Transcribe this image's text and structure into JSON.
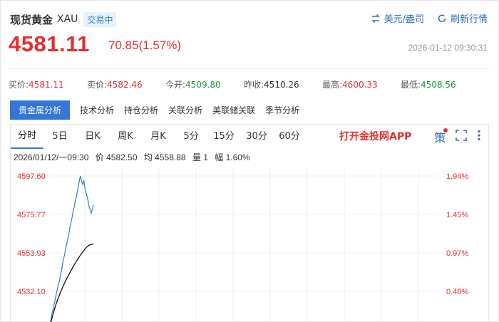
{
  "header": {
    "name": "现货黄金",
    "code": "XAU",
    "status": "交易中",
    "currency_btn": "美元/盎司",
    "refresh_btn": "刷新行情"
  },
  "quote": {
    "price": "4581.11",
    "change": "70.85(1.57%)",
    "time": "2026-01-12 09:30:31"
  },
  "stats": [
    {
      "label": "买价:",
      "value": "4581.11",
      "color": "red"
    },
    {
      "label": "卖价:",
      "value": "4582.46",
      "color": "red"
    },
    {
      "label": "今开:",
      "value": "4509.80",
      "color": "green"
    },
    {
      "label": "昨收:",
      "value": "4510.26",
      "color": "gray"
    },
    {
      "label": "最高:",
      "value": "4600.33",
      "color": "red"
    },
    {
      "label": "最低:",
      "value": "4508.56",
      "color": "green"
    }
  ],
  "analysis_tabs": [
    "贵金属分析",
    "技术分析",
    "持仓分析",
    "关联分析",
    "美联储关联",
    "季节分析"
  ],
  "period_tabs": [
    "分时",
    "5日",
    "日K",
    "周K",
    "月K",
    "5分",
    "15分",
    "30分",
    "60分"
  ],
  "promo": "打开金投网APP",
  "strategy_icon_label": "策",
  "info": {
    "datetime": "2026/01/12/一09:30",
    "price": "价 4582.50",
    "avg": "均 4558.88",
    "vol": "量 1",
    "amp": "幅 1.60%"
  },
  "chart_data": {
    "type": "line",
    "y_labels_left": [
      "4597.60",
      "4575.77",
      "4553.93",
      "4532.10"
    ],
    "y_labels_right": [
      "1.94%",
      "1.45%",
      "0.97%",
      "0.48%"
    ],
    "ylim": [
      4510.26,
      4597.6
    ],
    "series": [
      {
        "name": "",
        "color": "#2f7fd8",
        "values": [
          4512.5,
          4516.2,
          4519.8,
          4522.1,
          4524.9,
          4527.3,
          4530.6,
          4533.2,
          4535.8,
          4538.1,
          4541.4,
          4544.2,
          4547.9,
          4550.6,
          4553.4,
          4556.8,
          4559.1,
          4562.6,
          4565.2,
          4568.9,
          4571.5,
          4574.3,
          4577.8,
          4580.2,
          4583.6,
          4586.1,
          4589.4,
          4592.2,
          4595.8,
          4597.6,
          4594.2,
          4592.8,
          4595.1,
          4590.6,
          4588.3,
          4585.9,
          4583.4,
          4580.1,
          4578.6,
          4576.2,
          4578.9,
          4581.1
        ]
      },
      {
        "name": "",
        "color": "#111111",
        "values": [
          4512.0,
          4514.6,
          4517.0,
          4519.3,
          4521.4,
          4523.3,
          4525.2,
          4526.9,
          4528.5,
          4530.1,
          4531.6,
          4533.0,
          4534.4,
          4535.7,
          4537.0,
          4538.3,
          4539.5,
          4540.7,
          4541.8,
          4542.9,
          4544.0,
          4545.1,
          4546.2,
          4547.2,
          4548.2,
          4549.2,
          4550.2,
          4551.1,
          4552.0,
          4552.9,
          4553.7,
          4554.5,
          4555.3,
          4556.1,
          4556.8,
          4557.4,
          4557.9,
          4558.3,
          4558.6,
          4558.8,
          4558.9,
          4558.9
        ]
      }
    ],
    "grid": true
  }
}
